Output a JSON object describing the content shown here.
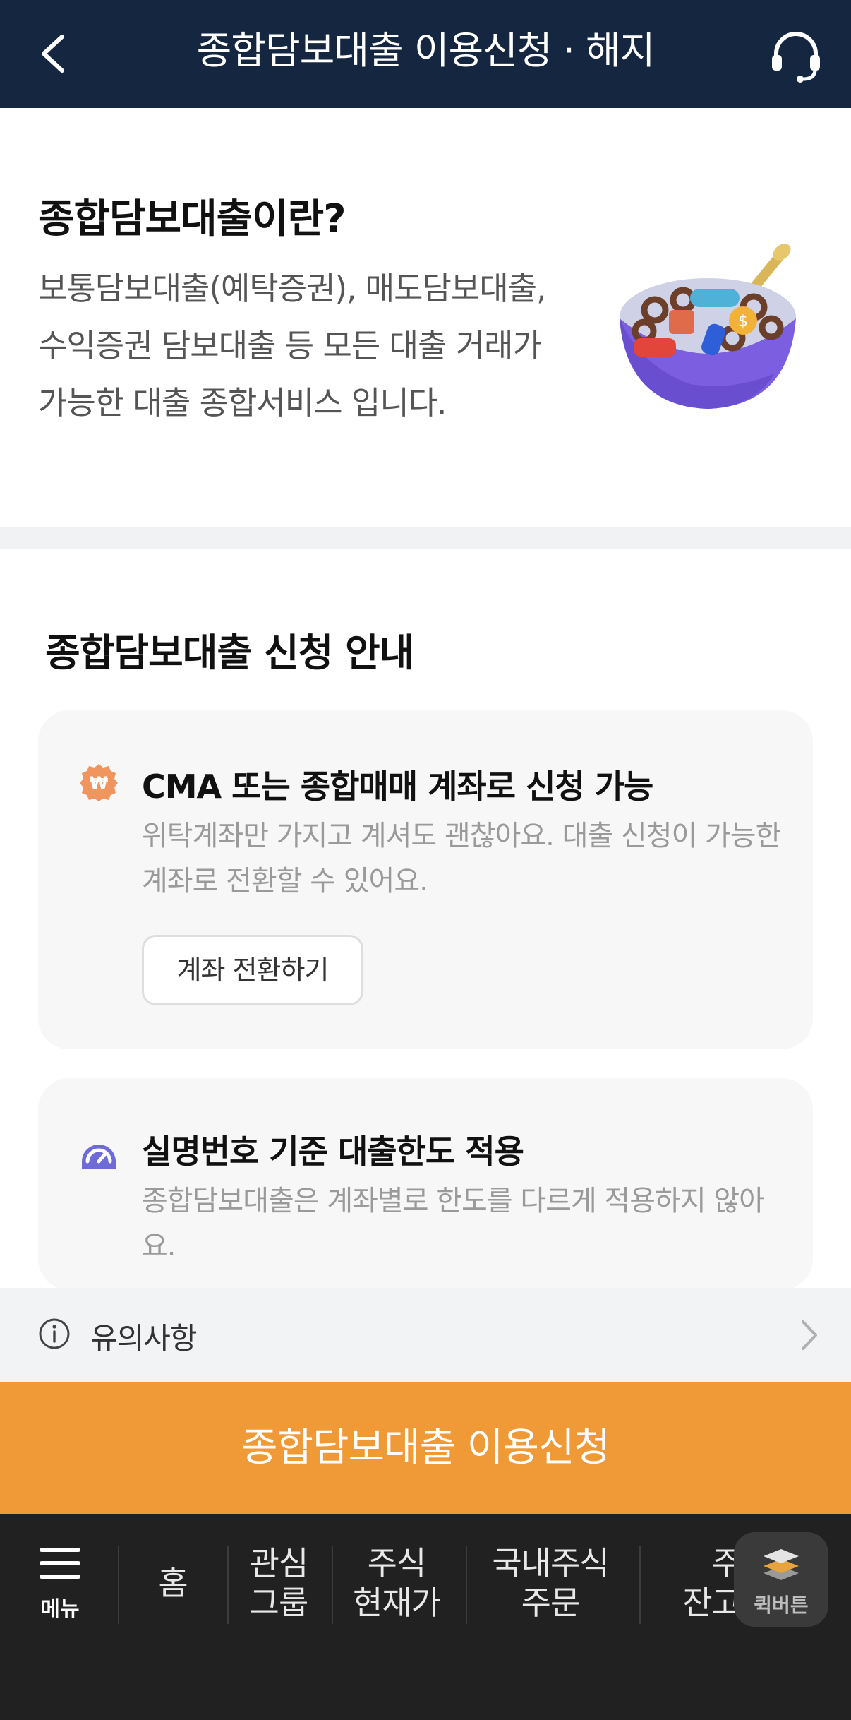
{
  "header": {
    "title": "종합담보대출 이용신청 · 해지"
  },
  "intro": {
    "heading": "종합담보대출이란?",
    "description": "보통담보대출(예탁증권), 매도담보대출, 수익증권 담보대출 등 모든 대출 거래가 가능한 대출 종합서비스 입니다."
  },
  "guide": {
    "title": "종합담보대출 신청 안내",
    "cards": [
      {
        "title": "CMA 또는 종합매매 계좌로 신청 가능",
        "description": "위탁계좌만 가지고 계셔도 괜찮아요. 대출 신청이 가능한 계좌로 전환할 수 있어요.",
        "button_label": "계좌 전환하기"
      },
      {
        "title": "실명번호 기준 대출한도 적용",
        "description": "종합담보대출은 계좌별로 한도를 다르게 적용하지 않아요."
      }
    ]
  },
  "notice": {
    "label": "유의사항"
  },
  "cta": {
    "label": "종합담보대출 이용신청"
  },
  "bottom_nav": {
    "menu_label": "메뉴",
    "items": [
      {
        "line1": "홈",
        "line2": ""
      },
      {
        "line1": "관심",
        "line2": "그룹"
      },
      {
        "line1": "주식",
        "line2": "현재가"
      },
      {
        "line1": "국내주식",
        "line2": "주문"
      },
      {
        "line1": "주",
        "line2": "잔고"
      }
    ],
    "quick_label": "퀵버튼"
  },
  "colors": {
    "header_bg": "#152640",
    "cta_bg": "#f09a37",
    "nav_bg": "#212121",
    "card_bg": "#f7f7f8"
  }
}
